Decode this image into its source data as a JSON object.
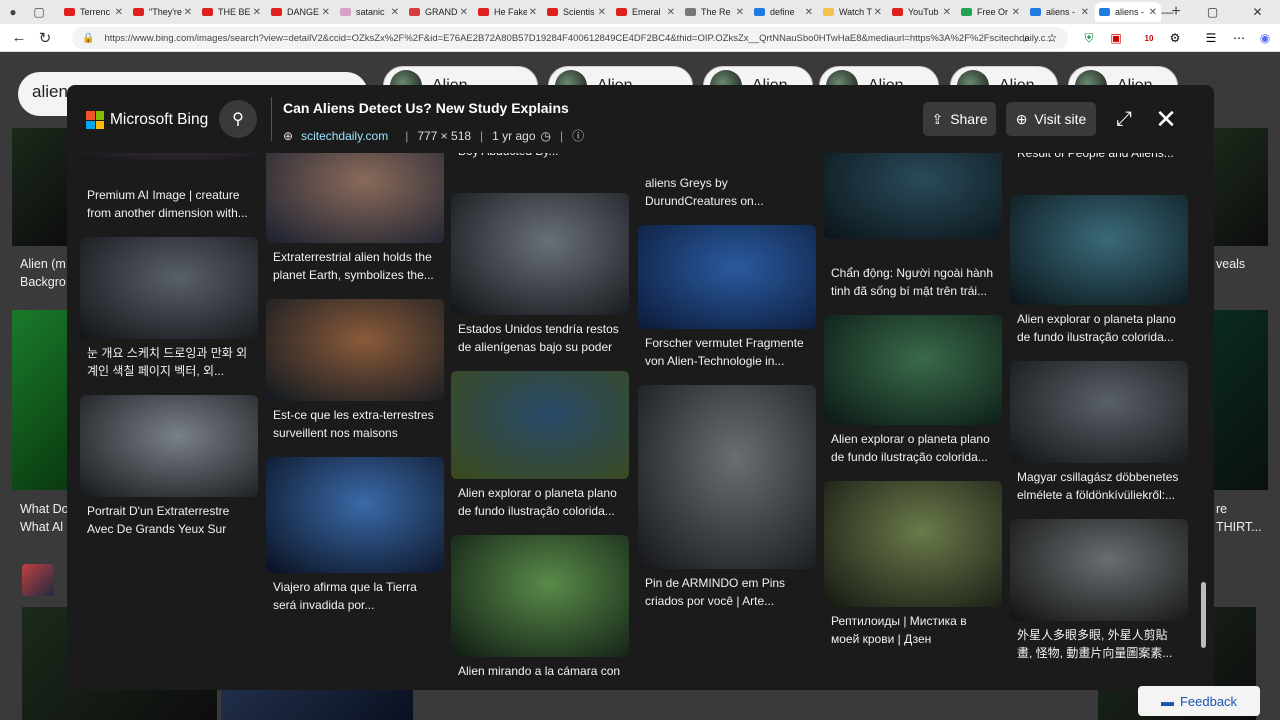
{
  "browser": {
    "tabs": [
      {
        "title": "Terrenc",
        "fav_color": "#e01f1f"
      },
      {
        "title": "\"They're",
        "fav_color": "#e01f1f"
      },
      {
        "title": "THE BE",
        "fav_color": "#e01f1f"
      },
      {
        "title": "DANGE",
        "fav_color": "#e01f1f"
      },
      {
        "title": "satanic",
        "fav_color": "#d9a0c8"
      },
      {
        "title": "GRAND",
        "fav_color": "#d83b3b"
      },
      {
        "title": "He Fake",
        "fav_color": "#e01f1f"
      },
      {
        "title": "Scientis",
        "fav_color": "#e01f1f"
      },
      {
        "title": "Emeral",
        "fav_color": "#e01f1f"
      },
      {
        "title": "The Re",
        "fav_color": "#777777"
      },
      {
        "title": "define",
        "fav_color": "#1e7be0"
      },
      {
        "title": "Watch T",
        "fav_color": "#f2c14e"
      },
      {
        "title": "YouTub",
        "fav_color": "#e01f1f"
      },
      {
        "title": "Free Or",
        "fav_color": "#23a455"
      },
      {
        "title": "aliens -",
        "fav_color": "#1e7be0"
      },
      {
        "title": "aliens -",
        "fav_color": "#1e7be0",
        "active": true
      }
    ],
    "url": "https://www.bing.com/images/search?view=detailV2&ccid=OZksZx%2F%2F&id=E76AE2B72A80B57D19284F400612849CE4DF2BC4&thid=OIP.OZksZx__QrtNNauSbo0HTwHaE8&mediaurl=https%3A%2F%2Fscitechdaily.c...",
    "ext_badge": "10"
  },
  "background": {
    "search_text": "aliens",
    "chips": [
      "Alien",
      "Alien",
      "Alien",
      "Alien",
      "Alien",
      "Alien"
    ],
    "left_captions": [
      "Alien (m",
      "Backgro",
      "What Do",
      "What Al"
    ],
    "right_captions": [
      "veals",
      "re",
      "THIRT..."
    ],
    "feedback_label": "Feedback"
  },
  "modal": {
    "brand": "Microsoft Bing",
    "title": "Can Aliens Detect Us? New Study Explains",
    "source": "scitechdaily.com",
    "dimensions": "777 × 518",
    "age": "1 yr ago",
    "share_label": "Share",
    "visit_label": "Visit site",
    "columns": [
      [
        {
          "caption": "",
          "h": 24,
          "g": [
            "#3a3040",
            "#151515"
          ]
        },
        {
          "caption": "Premium AI Image | creature from another dimension with...",
          "h": 0,
          "g": []
        },
        {
          "caption": "눈 개요 스케치 드로잉과 만화 외계인 색칠 페이지 벡터, 외...",
          "h": 102,
          "g": [
            "#5a6068",
            "#111418"
          ]
        },
        {
          "caption": "Portrait D'un Extraterrestre Avec De Grands Yeux Sur Un...",
          "h": 102,
          "g": [
            "#7a8088",
            "#15181b"
          ]
        }
      ],
      [
        {
          "caption": "Extraterrestrial alien holds the planet Earth, symbolizes the...",
          "h": 104,
          "g": [
            "#8a6a5a",
            "#1a2030"
          ]
        },
        {
          "caption": "Est-ce que les extra-terrestres surveillent nos maisons",
          "h": 102,
          "g": [
            "#8a5a3a",
            "#0f1820"
          ]
        },
        {
          "caption": "Viajero afirma que la Tierra será invadida por...",
          "h": 116,
          "g": [
            "#3a6aa8",
            "#0a1020"
          ]
        }
      ],
      [
        {
          "caption": "Boy Abducted By...",
          "h": 0,
          "g": []
        },
        {
          "caption": "Estados Unidos tendría restos de alienígenas bajo su poder",
          "h": 122,
          "g": [
            "#6a7078",
            "#101418"
          ]
        },
        {
          "caption": "Alien explorar o planeta plano de fundo ilustração colorida...",
          "h": 108,
          "g": [
            "#2a4a6a",
            "#3a4a1a"
          ]
        },
        {
          "caption": "Alien mirando a la cámara con",
          "h": 122,
          "g": [
            "#5a8a4a",
            "#0e1a12"
          ]
        }
      ],
      [
        {
          "caption": "",
          "h": 12,
          "g": [
            "#3a4048",
            "#151515"
          ]
        },
        {
          "caption": "aliens Greys by DurundCreatures on...",
          "h": 0,
          "g": []
        },
        {
          "caption": "Forscher vermutet Fragmente von Alien-Technologie in...",
          "h": 104,
          "g": [
            "#2a5aa0",
            "#0c1a38"
          ]
        },
        {
          "caption": "Pin de ARMINDO em Pins criados por você | Arte...",
          "h": 184,
          "g": [
            "#6a6e72",
            "#141618"
          ]
        }
      ],
      [
        {
          "caption": "",
          "h": 100,
          "g": [
            "#2a4a5a",
            "#0a1418"
          ]
        },
        {
          "caption": "Chẩn động: Người ngoài hành tinh đã sống bí mật trên trái...",
          "h": 0,
          "g": []
        },
        {
          "caption": "Alien explorar o planeta plano de fundo ilustração colorida...",
          "h": 110,
          "g": [
            "#3a6a4a",
            "#0a1814"
          ]
        },
        {
          "caption": "Рептилоиды | Мистика в моей крови | Дзен",
          "h": 126,
          "g": [
            "#6a7a4a",
            "#141812"
          ]
        }
      ],
      [
        {
          "caption": "Result of People and Aliens...",
          "h": 0,
          "g": []
        },
        {
          "caption": "Alien explorar o planeta plano de fundo ilustração colorida...",
          "h": 110,
          "g": [
            "#3a6a7a",
            "#0a1418"
          ]
        },
        {
          "caption": "Magyar csillagász döbbenetes elmélete a földönkívüliekről:...",
          "h": 102,
          "g": [
            "#5a6068",
            "#121416"
          ]
        },
        {
          "caption": "外星人多眼多眼, 外星人剪貼畫, 怪物, 動畫片向量圖案素...",
          "h": 102,
          "g": [
            "#6a6e70",
            "#101112"
          ]
        }
      ]
    ]
  }
}
